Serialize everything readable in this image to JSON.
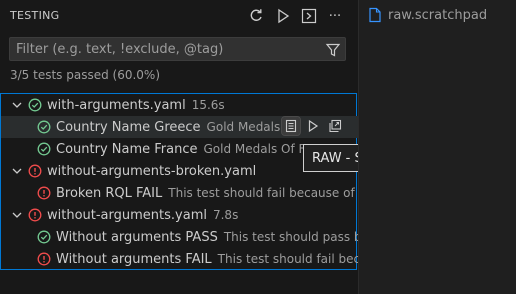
{
  "panel": {
    "title": "TESTING",
    "toolbar": {
      "refresh_icon": "refresh-icon",
      "run_icon": "run-all-icon",
      "debug_icon": "terminal-icon",
      "more_label": "···"
    },
    "filter": {
      "placeholder": "Filter (e.g. text, !exclude, @tag)",
      "value": ""
    },
    "summary": "3/5 tests passed (60.0%)"
  },
  "tree": [
    {
      "kind": "file",
      "label": "with-arguments.yaml",
      "desc": "15.6s",
      "status": "passed"
    },
    {
      "kind": "test",
      "label": "Country Name Greece",
      "desc": "Gold Medals ...",
      "status": "passed",
      "selected": true
    },
    {
      "kind": "test",
      "label": "Country Name France",
      "desc": "Gold Medals Of Fra",
      "status": "passed"
    },
    {
      "kind": "file",
      "label": "without-arguments-broken.yaml",
      "desc": "",
      "status": "failed"
    },
    {
      "kind": "test",
      "label": "Broken RQL FAIL",
      "desc": "This test should fail because of R...",
      "status": "failed"
    },
    {
      "kind": "file",
      "label": "without-arguments.yaml",
      "desc": "7.8s",
      "status": "failed"
    },
    {
      "kind": "test",
      "label": "Without arguments PASS",
      "desc": "This test should pass be...",
      "status": "passed"
    },
    {
      "kind": "test",
      "label": "Without arguments FAIL",
      "desc": "This test should fail beca...",
      "status": "failed"
    }
  ],
  "tooltip": "RAW - Show Output Data",
  "editor": {
    "tab_label": "raw.scratchpad"
  },
  "colors": {
    "passed": "#73c991",
    "failed": "#f14c4c",
    "accent": "#0078d4"
  }
}
